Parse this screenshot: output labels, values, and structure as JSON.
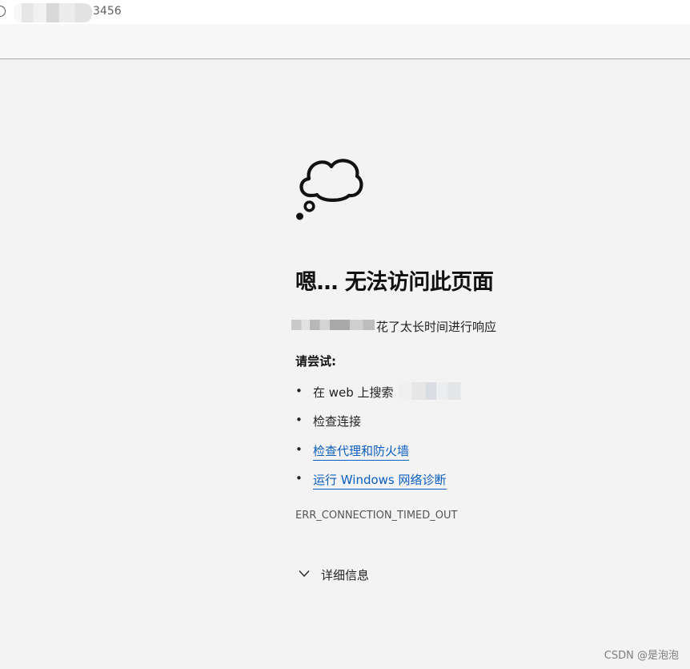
{
  "address_bar": {
    "url_visible_suffix": "3456"
  },
  "error_page": {
    "headline": "嗯… 无法访问此页面",
    "timeout_message": "花了太长时间进行响应",
    "try_heading": "请尝试:",
    "suggestions": [
      {
        "bullet": "•",
        "text": "在 web 上搜索",
        "is_link": false
      },
      {
        "bullet": "•",
        "text": "检查连接",
        "is_link": false
      },
      {
        "bullet": "•",
        "text": "检查代理和防火墙",
        "is_link": true
      },
      {
        "bullet": "•",
        "text": "运行 Windows 网络诊断",
        "is_link": true
      }
    ],
    "error_code": "ERR_CONNECTION_TIMED_OUT",
    "details_label": "详细信息"
  },
  "watermark": "CSDN @是泡泡",
  "colors": {
    "background": "#f3f3f3",
    "link": "#0a5ec2"
  },
  "icons": [
    "info-icon",
    "thought-cloud-icon",
    "chevron-down-icon"
  ]
}
